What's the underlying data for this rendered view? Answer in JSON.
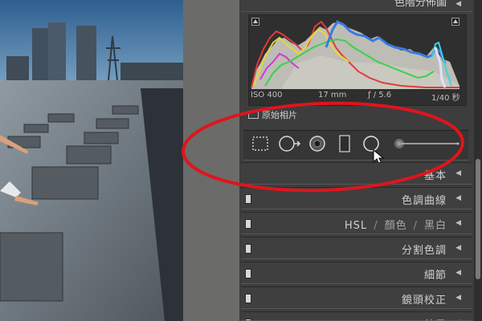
{
  "histogram_panel": {
    "title": "色階分佈圖",
    "exif": {
      "iso": "ISO 400",
      "focal_length": "17 mm",
      "aperture": "ƒ / 5.6",
      "shutter": "1/40 秒"
    },
    "original_photo_label": "原始相片"
  },
  "tools": [
    "crop-overlay-icon",
    "spot-removal-icon",
    "red-eye-icon",
    "graduated-filter-icon",
    "radial-filter-icon",
    "adjustment-brush-icon"
  ],
  "panels": [
    {
      "label": "基本"
    },
    {
      "label": "色調曲線"
    },
    {
      "hsl": "HSL",
      "color": "顏色",
      "bw": "黑白"
    },
    {
      "label": "分割色調"
    },
    {
      "label": "細節"
    },
    {
      "label": "鏡頭校正"
    },
    {
      "label": "效果"
    }
  ],
  "colors": {
    "annotation": "#e0141c",
    "panel_bg": "#3d3d3d",
    "header_bg": "#3f3f3f"
  }
}
